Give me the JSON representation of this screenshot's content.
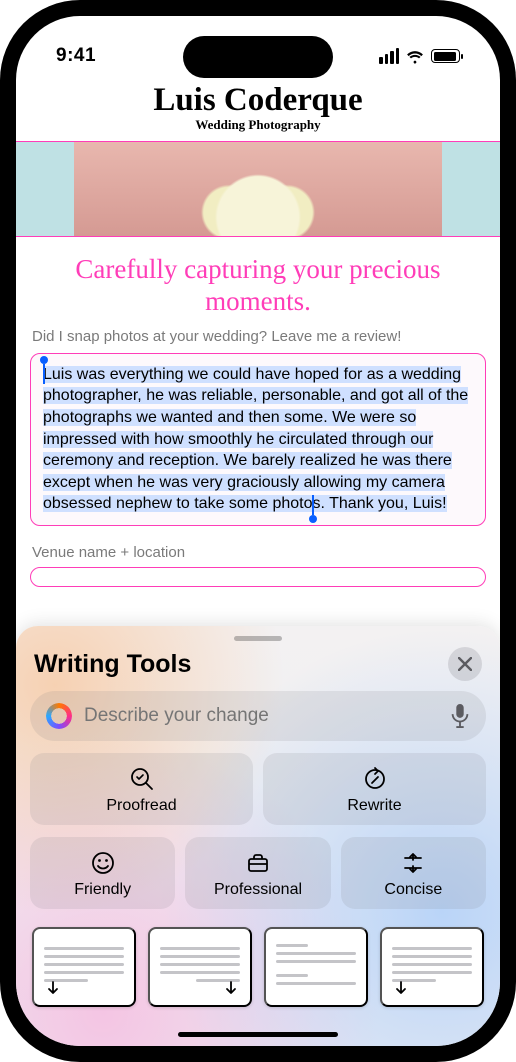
{
  "status": {
    "time": "9:41"
  },
  "header": {
    "title": "Luis Coderque",
    "subtitle": "Wedding Photography"
  },
  "headline": "Carefully capturing your precious moments.",
  "review_prompt": "Did I snap photos at your wedding? Leave me a review!",
  "review_text": "Luis was everything we could have hoped for as a wedding photographer, he was reliable, personable, and got all of the photographs we wanted and then some. We were so impressed with how smoothly he circulated through our ceremony and reception. We barely realized he was there except when he was very graciously allowing my camera obsessed nephew to take some photos. Thank you, Luis!",
  "venue_label": "Venue name + location",
  "sheet": {
    "title": "Writing Tools",
    "input_placeholder": "Describe your change",
    "tools": {
      "proofread": "Proofread",
      "rewrite": "Rewrite",
      "friendly": "Friendly",
      "professional": "Professional",
      "concise": "Concise"
    }
  }
}
